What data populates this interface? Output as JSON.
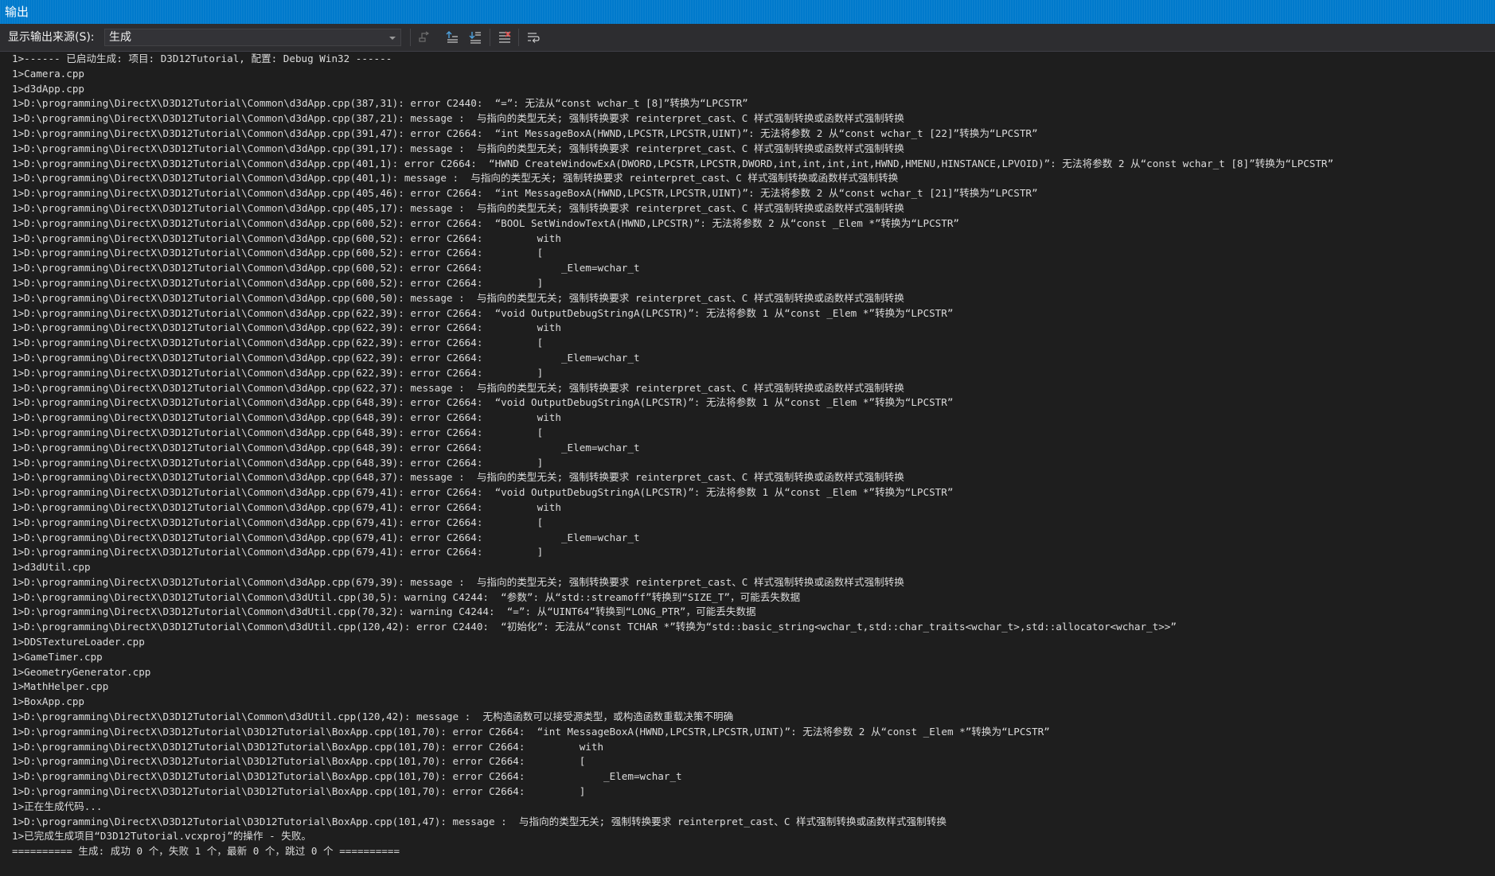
{
  "window": {
    "title": "输出"
  },
  "toolbar": {
    "source_label": "显示输出来源(S):",
    "source_value": "生成",
    "buttons": [
      {
        "icon": "find-message-icon"
      },
      {
        "icon": "go-to-previous-message-icon"
      },
      {
        "icon": "go-to-next-message-icon"
      },
      {
        "icon": "clear-all-icon"
      },
      {
        "icon": "toggle-word-wrap-icon"
      }
    ]
  },
  "colors": {
    "background": "#1e1e1e",
    "titlebar": "#007acc",
    "toolbar": "#2d2d30",
    "text": "#dcdcdc"
  },
  "output": {
    "lines": [
      "1>------ 已启动生成: 项目: D3D12Tutorial, 配置: Debug Win32 ------",
      "1>Camera.cpp",
      "1>d3dApp.cpp",
      "1>D:\\programming\\DirectX\\D3D12Tutorial\\Common\\d3dApp.cpp(387,31): error C2440:  “=”: 无法从“const wchar_t [8]”转换为“LPCSTR”",
      "1>D:\\programming\\DirectX\\D3D12Tutorial\\Common\\d3dApp.cpp(387,21): message :  与指向的类型无关; 强制转换要求 reinterpret_cast、C 样式强制转换或函数样式强制转换",
      "1>D:\\programming\\DirectX\\D3D12Tutorial\\Common\\d3dApp.cpp(391,47): error C2664:  “int MessageBoxA(HWND,LPCSTR,LPCSTR,UINT)”: 无法将参数 2 从“const wchar_t [22]”转换为“LPCSTR”",
      "1>D:\\programming\\DirectX\\D3D12Tutorial\\Common\\d3dApp.cpp(391,17): message :  与指向的类型无关; 强制转换要求 reinterpret_cast、C 样式强制转换或函数样式强制转换",
      "1>D:\\programming\\DirectX\\D3D12Tutorial\\Common\\d3dApp.cpp(401,1): error C2664:  “HWND CreateWindowExA(DWORD,LPCSTR,LPCSTR,DWORD,int,int,int,int,HWND,HMENU,HINSTANCE,LPVOID)”: 无法将参数 2 从“const wchar_t [8]”转换为“LPCSTR”",
      "1>D:\\programming\\DirectX\\D3D12Tutorial\\Common\\d3dApp.cpp(401,1): message :  与指向的类型无关; 强制转换要求 reinterpret_cast、C 样式强制转换或函数样式强制转换",
      "1>D:\\programming\\DirectX\\D3D12Tutorial\\Common\\d3dApp.cpp(405,46): error C2664:  “int MessageBoxA(HWND,LPCSTR,LPCSTR,UINT)”: 无法将参数 2 从“const wchar_t [21]”转换为“LPCSTR”",
      "1>D:\\programming\\DirectX\\D3D12Tutorial\\Common\\d3dApp.cpp(405,17): message :  与指向的类型无关; 强制转换要求 reinterpret_cast、C 样式强制转换或函数样式强制转换",
      "1>D:\\programming\\DirectX\\D3D12Tutorial\\Common\\d3dApp.cpp(600,52): error C2664:  “BOOL SetWindowTextA(HWND,LPCSTR)”: 无法将参数 2 从“const _Elem *”转换为“LPCSTR”",
      "1>D:\\programming\\DirectX\\D3D12Tutorial\\Common\\d3dApp.cpp(600,52): error C2664:         with",
      "1>D:\\programming\\DirectX\\D3D12Tutorial\\Common\\d3dApp.cpp(600,52): error C2664:         [",
      "1>D:\\programming\\DirectX\\D3D12Tutorial\\Common\\d3dApp.cpp(600,52): error C2664:             _Elem=wchar_t",
      "1>D:\\programming\\DirectX\\D3D12Tutorial\\Common\\d3dApp.cpp(600,52): error C2664:         ]",
      "1>D:\\programming\\DirectX\\D3D12Tutorial\\Common\\d3dApp.cpp(600,50): message :  与指向的类型无关; 强制转换要求 reinterpret_cast、C 样式强制转换或函数样式强制转换",
      "1>D:\\programming\\DirectX\\D3D12Tutorial\\Common\\d3dApp.cpp(622,39): error C2664:  “void OutputDebugStringA(LPCSTR)”: 无法将参数 1 从“const _Elem *”转换为“LPCSTR”",
      "1>D:\\programming\\DirectX\\D3D12Tutorial\\Common\\d3dApp.cpp(622,39): error C2664:         with",
      "1>D:\\programming\\DirectX\\D3D12Tutorial\\Common\\d3dApp.cpp(622,39): error C2664:         [",
      "1>D:\\programming\\DirectX\\D3D12Tutorial\\Common\\d3dApp.cpp(622,39): error C2664:             _Elem=wchar_t",
      "1>D:\\programming\\DirectX\\D3D12Tutorial\\Common\\d3dApp.cpp(622,39): error C2664:         ]",
      "1>D:\\programming\\DirectX\\D3D12Tutorial\\Common\\d3dApp.cpp(622,37): message :  与指向的类型无关; 强制转换要求 reinterpret_cast、C 样式强制转换或函数样式强制转换",
      "1>D:\\programming\\DirectX\\D3D12Tutorial\\Common\\d3dApp.cpp(648,39): error C2664:  “void OutputDebugStringA(LPCSTR)”: 无法将参数 1 从“const _Elem *”转换为“LPCSTR”",
      "1>D:\\programming\\DirectX\\D3D12Tutorial\\Common\\d3dApp.cpp(648,39): error C2664:         with",
      "1>D:\\programming\\DirectX\\D3D12Tutorial\\Common\\d3dApp.cpp(648,39): error C2664:         [",
      "1>D:\\programming\\DirectX\\D3D12Tutorial\\Common\\d3dApp.cpp(648,39): error C2664:             _Elem=wchar_t",
      "1>D:\\programming\\DirectX\\D3D12Tutorial\\Common\\d3dApp.cpp(648,39): error C2664:         ]",
      "1>D:\\programming\\DirectX\\D3D12Tutorial\\Common\\d3dApp.cpp(648,37): message :  与指向的类型无关; 强制转换要求 reinterpret_cast、C 样式强制转换或函数样式强制转换",
      "1>D:\\programming\\DirectX\\D3D12Tutorial\\Common\\d3dApp.cpp(679,41): error C2664:  “void OutputDebugStringA(LPCSTR)”: 无法将参数 1 从“const _Elem *”转换为“LPCSTR”",
      "1>D:\\programming\\DirectX\\D3D12Tutorial\\Common\\d3dApp.cpp(679,41): error C2664:         with",
      "1>D:\\programming\\DirectX\\D3D12Tutorial\\Common\\d3dApp.cpp(679,41): error C2664:         [",
      "1>D:\\programming\\DirectX\\D3D12Tutorial\\Common\\d3dApp.cpp(679,41): error C2664:             _Elem=wchar_t",
      "1>D:\\programming\\DirectX\\D3D12Tutorial\\Common\\d3dApp.cpp(679,41): error C2664:         ]",
      "1>d3dUtil.cpp",
      "1>D:\\programming\\DirectX\\D3D12Tutorial\\Common\\d3dApp.cpp(679,39): message :  与指向的类型无关; 强制转换要求 reinterpret_cast、C 样式强制转换或函数样式强制转换",
      "1>D:\\programming\\DirectX\\D3D12Tutorial\\Common\\d3dUtil.cpp(30,5): warning C4244:  “参数”: 从“std::streamoff”转换到“SIZE_T”，可能丢失数据",
      "1>D:\\programming\\DirectX\\D3D12Tutorial\\Common\\d3dUtil.cpp(70,32): warning C4244:  “=”: 从“UINT64”转换到“LONG_PTR”，可能丢失数据",
      "1>D:\\programming\\DirectX\\D3D12Tutorial\\Common\\d3dUtil.cpp(120,42): error C2440:  “初始化”: 无法从“const TCHAR *”转换为“std::basic_string<wchar_t,std::char_traits<wchar_t>,std::allocator<wchar_t>>”",
      "1>DDSTextureLoader.cpp",
      "1>GameTimer.cpp",
      "1>GeometryGenerator.cpp",
      "1>MathHelper.cpp",
      "1>BoxApp.cpp",
      "1>D:\\programming\\DirectX\\D3D12Tutorial\\Common\\d3dUtil.cpp(120,42): message :  无构造函数可以接受源类型，或构造函数重载决策不明确",
      "1>D:\\programming\\DirectX\\D3D12Tutorial\\D3D12Tutorial\\BoxApp.cpp(101,70): error C2664:  “int MessageBoxA(HWND,LPCSTR,LPCSTR,UINT)”: 无法将参数 2 从“const _Elem *”转换为“LPCSTR”",
      "1>D:\\programming\\DirectX\\D3D12Tutorial\\D3D12Tutorial\\BoxApp.cpp(101,70): error C2664:         with",
      "1>D:\\programming\\DirectX\\D3D12Tutorial\\D3D12Tutorial\\BoxApp.cpp(101,70): error C2664:         [",
      "1>D:\\programming\\DirectX\\D3D12Tutorial\\D3D12Tutorial\\BoxApp.cpp(101,70): error C2664:             _Elem=wchar_t",
      "1>D:\\programming\\DirectX\\D3D12Tutorial\\D3D12Tutorial\\BoxApp.cpp(101,70): error C2664:         ]",
      "1>正在生成代码...",
      "1>D:\\programming\\DirectX\\D3D12Tutorial\\D3D12Tutorial\\BoxApp.cpp(101,47): message :  与指向的类型无关; 强制转换要求 reinterpret_cast、C 样式强制转换或函数样式强制转换",
      "1>已完成生成项目“D3D12Tutorial.vcxproj”的操作 - 失败。",
      "========== 生成: 成功 0 个，失败 1 个，最新 0 个，跳过 0 个 =========="
    ]
  }
}
